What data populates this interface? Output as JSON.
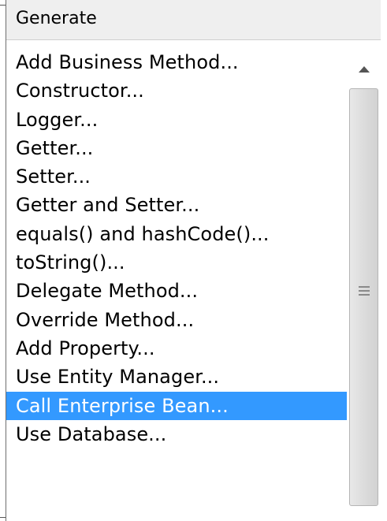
{
  "popup": {
    "title": "Generate",
    "items": [
      {
        "label": "Add Business Method..."
      },
      {
        "label": "Constructor..."
      },
      {
        "label": "Logger..."
      },
      {
        "label": "Getter..."
      },
      {
        "label": "Setter..."
      },
      {
        "label": "Getter and Setter..."
      },
      {
        "label": "equals() and hashCode()..."
      },
      {
        "label": "toString()..."
      },
      {
        "label": "Delegate Method..."
      },
      {
        "label": "Override Method..."
      },
      {
        "label": "Add Property..."
      },
      {
        "label": "Use Entity Manager..."
      },
      {
        "label": "Call Enterprise Bean..."
      },
      {
        "label": "Use Database..."
      }
    ],
    "selected_label": "Call Enterprise Bean..."
  },
  "colors": {
    "selection": "#3399ff",
    "header_bg": "#efefef"
  },
  "icons": {
    "scroll_up": "chevron-up-icon",
    "scroll_grip": "grip-lines-icon"
  }
}
